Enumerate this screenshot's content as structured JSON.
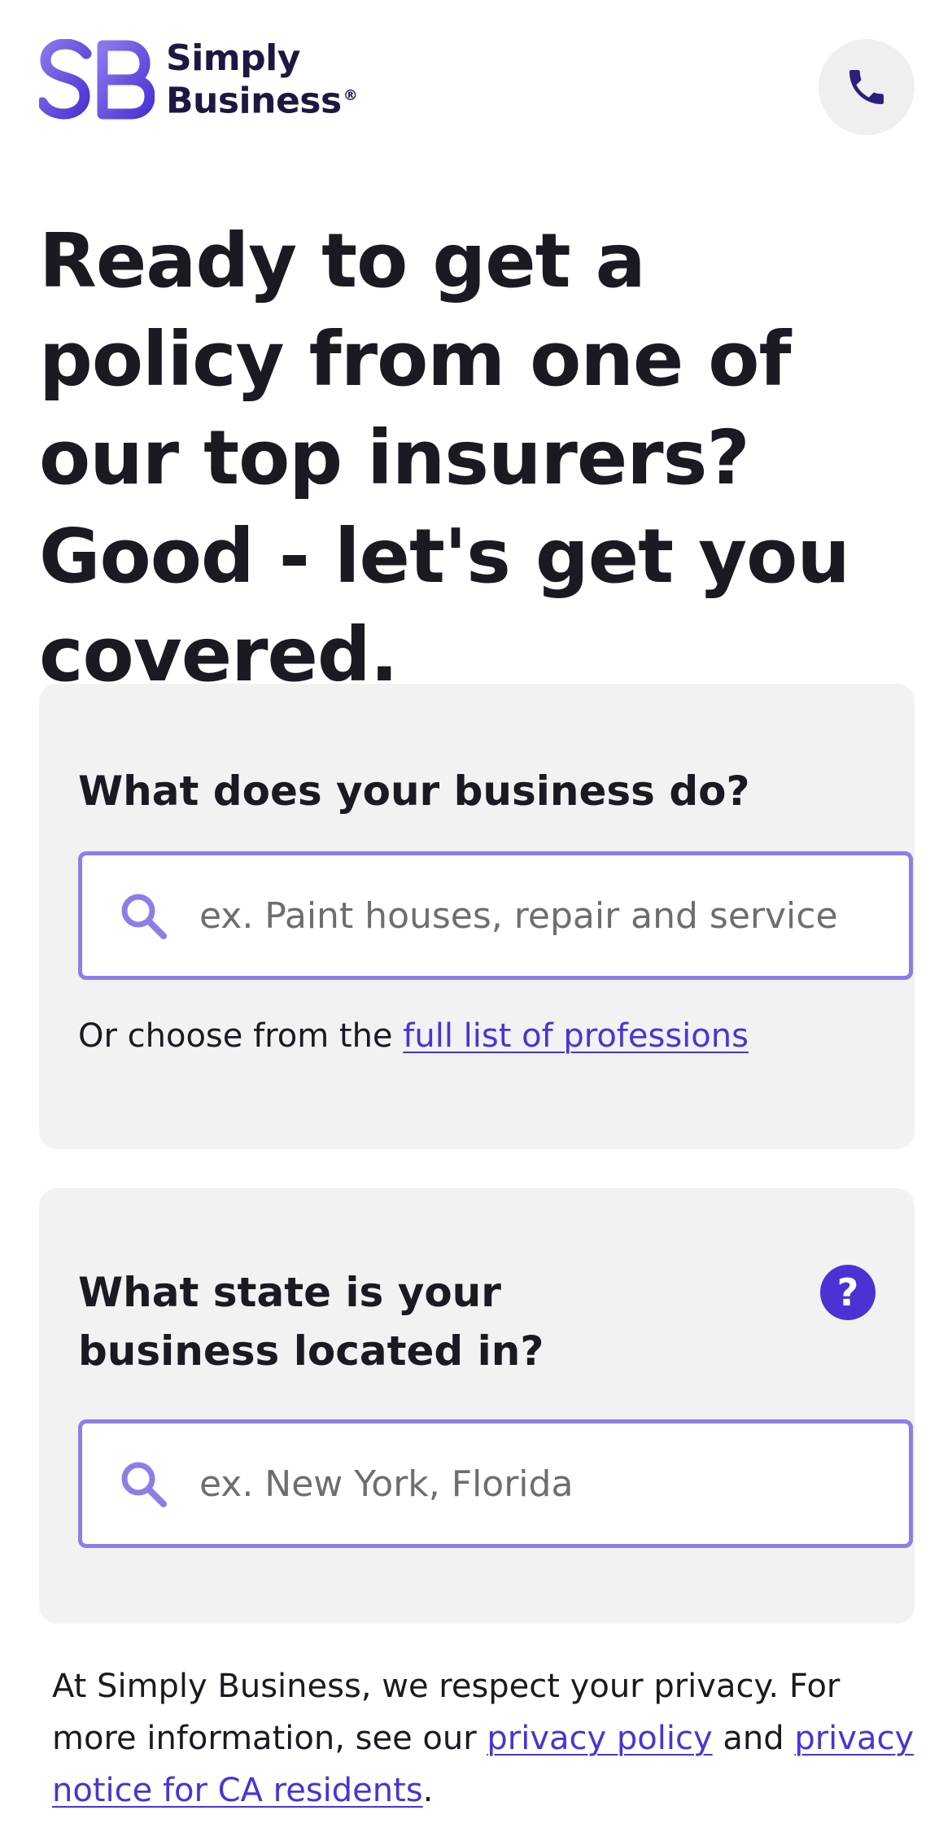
{
  "header": {
    "brand_line1": "Simply",
    "brand_line2": "Business",
    "brand_reg": "®",
    "logo_icon": "sb-logo-mark",
    "phone_icon": "phone-icon"
  },
  "hero": {
    "title": "Ready to get a policy from one of our top insurers? Good - let's get you covered."
  },
  "business_card": {
    "label": "What does your business do?",
    "search_placeholder": "ex. Paint houses, repair and service",
    "search_icon": "search-icon",
    "or_text": "Or choose from the ",
    "professions_link": "full list of professions"
  },
  "state_card": {
    "label": "What state is your business located in?",
    "help_symbol": "?",
    "search_placeholder": "ex. New York, Florida",
    "search_icon": "search-icon"
  },
  "privacy": {
    "text_before": "At Simply Business, we respect your privacy. For more information, see our ",
    "privacy_policy_link": "privacy policy",
    "text_and": " and ",
    "ca_notice_link": "privacy notice for CA residents",
    "text_end": "."
  },
  "colors": {
    "brand_purple": "#4a32d4",
    "field_border": "#8c7ee6",
    "logo_gradient_start": "#8a78ec",
    "logo_gradient_end": "#4a32d4",
    "card_background": "#f2f2f2"
  }
}
